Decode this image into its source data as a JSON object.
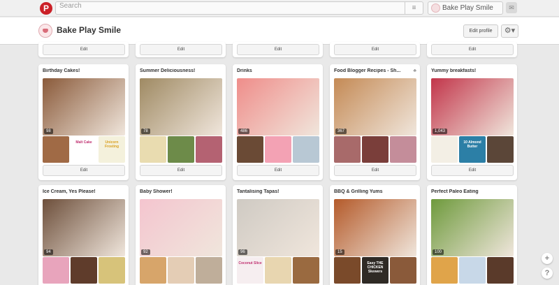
{
  "topbar": {
    "logo": "P",
    "search_placeholder": "Search",
    "search_menu_icon": "≡",
    "user_name": "Bake Play Smile",
    "messages_icon": "✉"
  },
  "profile": {
    "name": "Bake Play Smile",
    "edit_profile_label": "Edit profile",
    "settings_icon": "⚙▾"
  },
  "edit_label": "Edit",
  "boards": [
    {
      "title": "Birthday Cakes!",
      "count": "98",
      "cover_color": "#8a5a3a",
      "thumbs": [
        {
          "color": "#a06a45",
          "text": ""
        },
        {
          "color": "#ffffff",
          "text": "Malt Cake",
          "text_color": "#c03070"
        },
        {
          "color": "#f4f1dc",
          "text": "Unicorn Frosting",
          "text_color": "#d9a020"
        }
      ]
    },
    {
      "title": "Summer Deliciousness!",
      "count": "78",
      "cover_color": "#9f8a63",
      "thumbs": [
        {
          "color": "#e9dcb0",
          "text": ""
        },
        {
          "color": "#6d8b49",
          "text": ""
        },
        {
          "color": "#b46272",
          "text": ""
        }
      ]
    },
    {
      "title": "Drinks",
      "count": "486",
      "cover_color": "#ef8d8a",
      "thumbs": [
        {
          "color": "#6a4a35",
          "text": ""
        },
        {
          "color": "#f3a2b4",
          "text": ""
        },
        {
          "color": "#b8c8d4",
          "text": ""
        }
      ]
    },
    {
      "title": "Food Blogger Recipes - Sh...",
      "collab": "♣",
      "count": "367",
      "cover_color": "#c48a55",
      "thumbs": [
        {
          "color": "#a86a6a",
          "text": ""
        },
        {
          "color": "#7a3e3a",
          "text": ""
        },
        {
          "color": "#c48d9a",
          "text": ""
        }
      ]
    },
    {
      "title": "Yummy breakfasts!",
      "count": "1,043",
      "cover_color": "#c2354a",
      "thumbs": [
        {
          "color": "#f3efe5",
          "text": ""
        },
        {
          "color": "#2c7fa6",
          "text": "10 Almond Butter",
          "text_color": "#ffffff"
        },
        {
          "color": "#5b4638",
          "text": ""
        }
      ]
    },
    {
      "title": "Ice Cream, Yes Please!",
      "count": "94",
      "cover_color": "#6d4f3b",
      "thumbs": [
        {
          "color": "#e8a4bc",
          "text": ""
        },
        {
          "color": "#5f3c2b",
          "text": ""
        },
        {
          "color": "#d7c37a",
          "text": ""
        }
      ]
    },
    {
      "title": "Baby Shower!",
      "count": "92",
      "cover_color": "#f4c5cf",
      "thumbs": [
        {
          "color": "#d7a56a",
          "text": ""
        },
        {
          "color": "#e4cdb5",
          "text": ""
        },
        {
          "color": "#bfae9a",
          "text": ""
        }
      ]
    },
    {
      "title": "Tantalising Tapas!",
      "count": "96",
      "cover_color": "#cfcac3",
      "thumbs": [
        {
          "color": "#f6eef0",
          "text": "Coconut Slice",
          "text_color": "#c03070"
        },
        {
          "color": "#e8d6b0",
          "text": ""
        },
        {
          "color": "#9a6a40",
          "text": ""
        }
      ]
    },
    {
      "title": "BBQ & Grilling Yums",
      "count": "15",
      "cover_color": "#b45a2a",
      "thumbs": [
        {
          "color": "#7a4a2a",
          "text": ""
        },
        {
          "color": "#2f2a25",
          "text": "Easy THE CHICKEN Skewers",
          "text_color": "#ffffff"
        },
        {
          "color": "#8a5a3a",
          "text": ""
        }
      ]
    },
    {
      "title": "Perfect Paleo Eating",
      "count": "100",
      "cover_color": "#6e9a3c",
      "thumbs": [
        {
          "color": "#e0a44a",
          "text": ""
        },
        {
          "color": "#c8d8e8",
          "text": ""
        },
        {
          "color": "#5a3a2a",
          "text": ""
        }
      ]
    }
  ],
  "float": {
    "add_icon": "+",
    "help_icon": "?"
  }
}
